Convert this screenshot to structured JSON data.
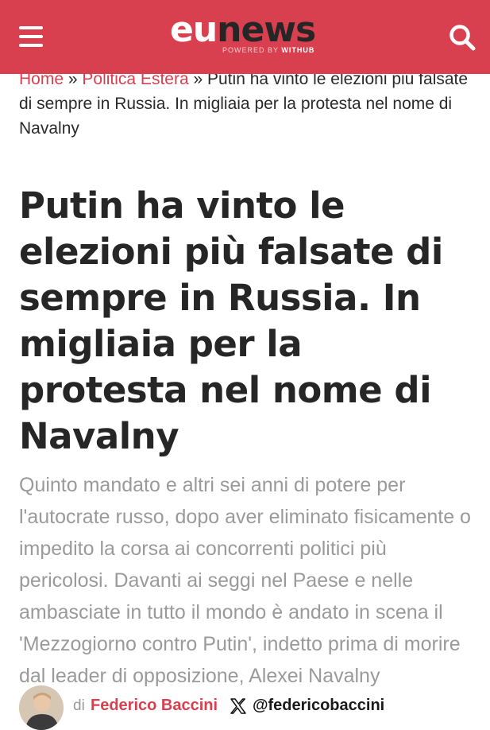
{
  "header": {
    "logo_primary": "eu",
    "logo_secondary": "news",
    "logo_tagline": "POWERED BY",
    "logo_tagline_brand": "WITHUB",
    "background_color": "#d8404f",
    "menu_icon": "hamburger-menu-icon",
    "search_icon": "search-icon"
  },
  "breadcrumb": {
    "home": "Home",
    "separator": "»",
    "section": "Politica Estera",
    "current": "Putin ha vinto le elezioni più falsate di sempre in Russia. In migliaia per la protesta nel nome di Navalny"
  },
  "article": {
    "title": "Putin ha vinto le elezioni più falsate di sempre in Russia. In migliaia per la protesta nel nome di Navalny",
    "summary": "Quinto mandato e altri sei anni di potere per l'autocrate russo, dopo aver eliminato fisicamente o impedito la corsa ai concorrenti politici più pericolosi. Davanti ai seggi nel Paese e nelle ambasciate in tutto il mondo è andato in scena il 'Mezzogiorno contro Putin', indetto prima di morire dal leader di opposizione, Alexei Navalny"
  },
  "byline": {
    "prefix": "di",
    "author": "Federico Baccini",
    "social_icon": "x-logo-icon",
    "social_handle": "@federicobaccini"
  },
  "colors": {
    "accent": "#d8404f",
    "text_dark": "#262626",
    "text_muted": "#9a9a9a"
  }
}
